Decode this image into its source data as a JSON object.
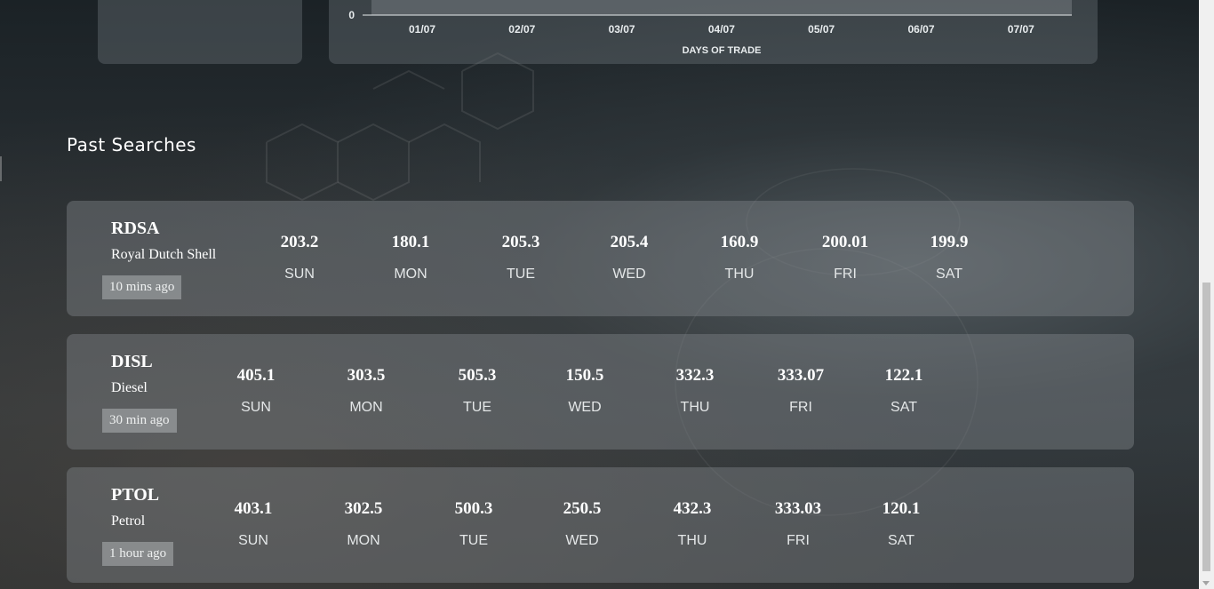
{
  "top_chart": {
    "y_tick": "0",
    "x_ticks": [
      "01/07",
      "02/07",
      "03/07",
      "04/07",
      "05/07",
      "06/07",
      "07/07"
    ],
    "xlabel": "DAYS OF TRADE"
  },
  "past_searches": {
    "title": "Past Searches",
    "items": [
      {
        "symbol": "RDSA",
        "name": "Royal Dutch Shell",
        "ago": "10 mins ago",
        "days": [
          {
            "value": "203.2",
            "label": "SUN"
          },
          {
            "value": "180.1",
            "label": "MON"
          },
          {
            "value": "205.3",
            "label": "TUE"
          },
          {
            "value": "205.4",
            "label": "WED"
          },
          {
            "value": "160.9",
            "label": "THU"
          },
          {
            "value": "200.01",
            "label": "FRI"
          },
          {
            "value": "199.9",
            "label": "SAT"
          }
        ]
      },
      {
        "symbol": "DISL",
        "name": "Diesel",
        "ago": "30 min ago",
        "days": [
          {
            "value": "405.1",
            "label": "SUN"
          },
          {
            "value": "303.5",
            "label": "MON"
          },
          {
            "value": "505.3",
            "label": "TUE"
          },
          {
            "value": "150.5",
            "label": "WED"
          },
          {
            "value": "332.3",
            "label": "THU"
          },
          {
            "value": "333.07",
            "label": "FRI"
          },
          {
            "value": "122.1",
            "label": "SAT"
          }
        ]
      },
      {
        "symbol": "PTOL",
        "name": "Petrol",
        "ago": "1 hour ago",
        "days": [
          {
            "value": "403.1",
            "label": "SUN"
          },
          {
            "value": "302.5",
            "label": "MON"
          },
          {
            "value": "500.3",
            "label": "TUE"
          },
          {
            "value": "250.5",
            "label": "WED"
          },
          {
            "value": "432.3",
            "label": "THU"
          },
          {
            "value": "333.03",
            "label": "FRI"
          },
          {
            "value": "120.1",
            "label": "SAT"
          }
        ]
      }
    ]
  }
}
